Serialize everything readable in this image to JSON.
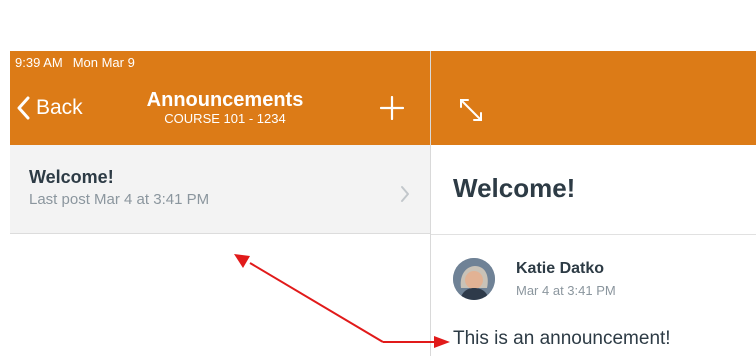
{
  "status_bar": {
    "time": "9:39 AM",
    "date": "Mon Mar 9"
  },
  "nav": {
    "back_label": "Back",
    "title": "Announcements",
    "subtitle": "COURSE 101 - 1234"
  },
  "announcements": [
    {
      "title": "Welcome!",
      "last_post": "Last post Mar 4 at 3:41 PM"
    }
  ],
  "detail": {
    "title": "Welcome!",
    "author": "Katie Datko",
    "date": "Mar 4 at 3:41 PM",
    "message": "This is an announcement!"
  },
  "colors": {
    "brand_orange": "#dc7b17",
    "text_dark": "#2d3b45",
    "text_muted": "#8b969e",
    "annotation_red": "#e11a1a"
  },
  "icons": {
    "back": "chevron-left-icon",
    "add": "plus-icon",
    "expand": "expand-icon",
    "disclosure": "chevron-right-icon"
  }
}
